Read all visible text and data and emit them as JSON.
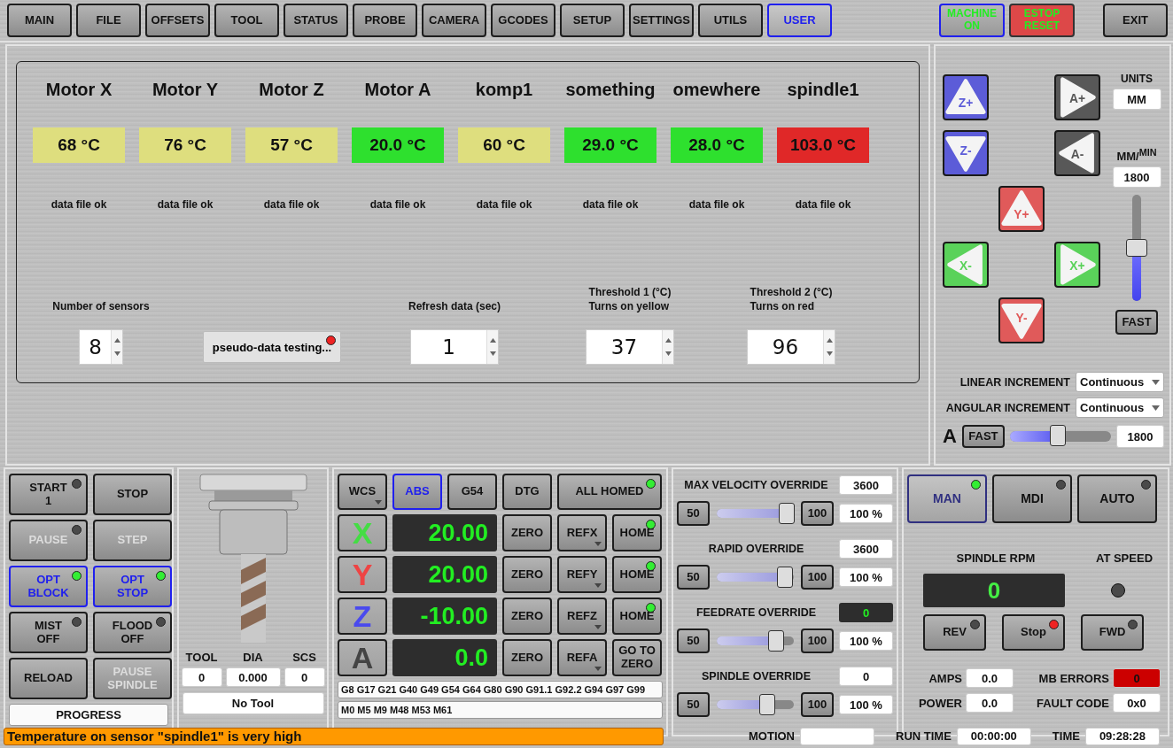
{
  "tabs": [
    {
      "label": "MAIN",
      "selected": false
    },
    {
      "label": "FILE",
      "selected": false
    },
    {
      "label": "OFFSETS",
      "selected": false
    },
    {
      "label": "TOOL",
      "selected": false
    },
    {
      "label": "STATUS",
      "selected": false
    },
    {
      "label": "PROBE",
      "selected": false
    },
    {
      "label": "CAMERA",
      "selected": false
    },
    {
      "label": "GCODES",
      "selected": false
    },
    {
      "label": "SETUP",
      "selected": false
    },
    {
      "label": "SETTINGS",
      "selected": false
    },
    {
      "label": "UTILS",
      "selected": false
    },
    {
      "label": "USER",
      "selected": true
    }
  ],
  "machine_buttons": [
    {
      "label": "MACHINE ON",
      "kind": "machine"
    },
    {
      "label": "ESTOP RESET",
      "kind": "estop"
    }
  ],
  "exit_button": "EXIT",
  "sensors": [
    {
      "name": "Motor X",
      "reading": "68 °C",
      "color": "#dede7e",
      "status": "data file ok"
    },
    {
      "name": "Motor Y",
      "reading": "76 °C",
      "color": "#dede7e",
      "status": "data file ok"
    },
    {
      "name": "Motor Z",
      "reading": "57 °C",
      "color": "#dede7e",
      "status": "data file ok"
    },
    {
      "name": "Motor A",
      "reading": "20.0 °C",
      "color": "#2ee02e",
      "status": "data file ok"
    },
    {
      "name": "komp1",
      "reading": "60 °C",
      "color": "#dede7e",
      "status": "data file ok"
    },
    {
      "name": "something",
      "reading": "29.0 °C",
      "color": "#2ee02e",
      "status": "data file ok"
    },
    {
      "name": "omewhere",
      "reading": "28.0 °C",
      "color": "#2ee02e",
      "status": "data file ok"
    },
    {
      "name": "spindle1",
      "reading": "103.0 °C",
      "color": "#e02828",
      "status": "data file ok"
    }
  ],
  "settings": [
    {
      "kind": "spin",
      "label": [
        "Number of sensors"
      ],
      "value": "8"
    },
    {
      "kind": "button",
      "label": [
        "pseudo-data testing..."
      ],
      "led": {
        "on": true,
        "color": "#ee2222"
      }
    },
    {
      "kind": "spin",
      "label": [
        "Refresh data (sec)"
      ],
      "value": "1"
    },
    {
      "kind": "spin",
      "label": [
        "Threshold 1 (°C)",
        "Turns on yellow"
      ],
      "value": "37"
    },
    {
      "kind": "spin",
      "label": [
        "Threshold 2 (°C)",
        "Turns on red"
      ],
      "value": "96"
    }
  ],
  "jog": {
    "buttons": [
      {
        "label": "Z+",
        "color": "#5c5cd8",
        "kind": "up"
      },
      {
        "label": "A+",
        "color": "#585858",
        "kind": "right"
      },
      {
        "label": "Z-",
        "color": "#5c5cd8",
        "kind": "down"
      },
      {
        "label": "A-",
        "color": "#585858",
        "kind": "left"
      },
      {
        "label": "Y+",
        "color": "#e05a5a",
        "kind": "up"
      },
      {
        "label": "X-",
        "color": "#5ad25a",
        "kind": "left"
      },
      {
        "label": "X+",
        "color": "#5ad25a",
        "kind": "right"
      },
      {
        "label": "Y-",
        "color": "#e05a5a",
        "kind": "down"
      }
    ],
    "units_label": "UNITS",
    "units": "MM",
    "rate_label": "MM/$^{MIN}$",
    "rate": "1800",
    "rate_slider": {
      "level": 0.5
    },
    "fast": "FAST",
    "increments": [
      {
        "label": "LINEAR INCREMENT",
        "value": "Continuous"
      },
      {
        "label": "ANGULAR INCREMENT",
        "value": "Continuous"
      }
    ],
    "angular": {
      "label": "A",
      "fast": "FAST",
      "level": 0.48,
      "rate": "1800"
    }
  },
  "program_buttons": [
    {
      "lines": [
        "START",
        "1"
      ],
      "led": {
        "on": false
      },
      "disabled": false,
      "active": false
    },
    {
      "lines": [
        "STOP"
      ],
      "disabled": false,
      "active": false
    },
    {
      "lines": [
        "PAUSE"
      ],
      "led": {
        "on": false
      },
      "disabled": true,
      "active": false
    },
    {
      "lines": [
        "STEP"
      ],
      "disabled": true,
      "active": false
    },
    {
      "lines": [
        "OPT",
        "BLOCK"
      ],
      "led": {
        "on": true,
        "color": "#33ee33"
      },
      "disabled": false,
      "active": true
    },
    {
      "lines": [
        "OPT",
        "STOP"
      ],
      "led": {
        "on": true,
        "color": "#33ee33"
      },
      "disabled": false,
      "active": true
    },
    {
      "lines": [
        "MIST",
        "OFF"
      ],
      "led": {
        "on": false
      },
      "disabled": false,
      "active": false
    },
    {
      "lines": [
        "FLOOD",
        "OFF"
      ],
      "led": {
        "on": false
      },
      "disabled": false,
      "active": false
    },
    {
      "lines": [
        "RELOAD"
      ],
      "disabled": false,
      "active": false
    },
    {
      "lines": [
        "PAUSE",
        "SPINDLE"
      ],
      "disabled": true,
      "active": false
    }
  ],
  "progress": {
    "label": "PROGRESS",
    "level": 0
  },
  "tool": {
    "columns": [
      {
        "label": "TOOL",
        "value": "0"
      },
      {
        "label": "DIA",
        "value": "0.000"
      },
      {
        "label": "SCS",
        "value": "0"
      }
    ],
    "description": "No Tool"
  },
  "dro": {
    "header": [
      {
        "label": "WCS",
        "kind": "dropdown",
        "selected": false
      },
      {
        "label": "ABS",
        "kind": "plain",
        "selected": true
      },
      {
        "label": "G54",
        "kind": "plain",
        "selected": false
      },
      {
        "label": "DTG",
        "kind": "plain",
        "selected": false
      }
    ],
    "homed": {
      "label": "ALL HOMED",
      "led": {
        "on": true,
        "color": "#33ee33"
      }
    },
    "axes": [
      {
        "axis": "X",
        "color": "#44dd44",
        "value": "20.00",
        "zero": "ZERO",
        "ref": "REFX",
        "home": "HOME",
        "home_led": {
          "on": true,
          "color": "#33ee33"
        }
      },
      {
        "axis": "Y",
        "color": "#ee4444",
        "value": "20.00",
        "zero": "ZERO",
        "ref": "REFY",
        "home": "HOME",
        "home_led": {
          "on": true,
          "color": "#33ee33"
        }
      },
      {
        "axis": "Z",
        "color": "#4a4aee",
        "value": "-10.00",
        "zero": "ZERO",
        "ref": "REFZ",
        "home": "HOME",
        "home_led": {
          "on": true,
          "color": "#33ee33"
        }
      },
      {
        "axis": "A",
        "color": "#444444",
        "value": "0.0",
        "zero": "ZERO",
        "ref": "REFA",
        "home": "GO TO ZERO"
      }
    ],
    "gcodes": [
      "G8 G17 G21 G40 G49 G54 G64 G80 G90 G91.1 G92.2 G94 G97 G99",
      "M0 M5 M9 M48 M53 M61"
    ]
  },
  "overrides": [
    {
      "title": "MAX VELOCITY OVERRIDE",
      "value": "3600",
      "kind": "field",
      "low": "50",
      "high": "100",
      "level": 0.92,
      "percent": "100 %"
    },
    {
      "title": "RAPID OVERRIDE",
      "value": "3600",
      "kind": "field",
      "low": "50",
      "high": "100",
      "level": 0.9,
      "percent": "100 %"
    },
    {
      "title": "FEEDRATE OVERRIDE",
      "value": "0",
      "kind": "display",
      "low": "50",
      "high": "100",
      "level": 0.78,
      "percent": "100 %"
    },
    {
      "title": "SPINDLE OVERRIDE",
      "value": "0",
      "kind": "field",
      "low": "50",
      "high": "100",
      "level": 0.67,
      "percent": "100 %"
    }
  ],
  "mode": {
    "buttons": [
      {
        "label": "MAN",
        "selected": true,
        "led": {
          "on": true,
          "color": "#33ee33"
        }
      },
      {
        "label": "MDI",
        "selected": false,
        "led": {
          "on": false
        }
      },
      {
        "label": "AUTO",
        "selected": false,
        "led": {
          "on": false
        }
      }
    ],
    "rpm_label": "SPINDLE RPM",
    "at_speed_label": "AT SPEED",
    "rpm": "0",
    "at_speed_led": {
      "on": false
    },
    "spindle_buttons": [
      {
        "label": "REV",
        "led": {
          "on": false
        }
      },
      {
        "label": "Stop",
        "led": {
          "on": true,
          "color": "#ee2222"
        }
      },
      {
        "label": "FWD",
        "led": {
          "on": false
        }
      }
    ],
    "readouts": [
      {
        "label": "AMPS",
        "value": "0.0",
        "alarm": false
      },
      {
        "label": "MB ERRORS",
        "value": "0",
        "alarm": true
      },
      {
        "label": "POWER",
        "value": "0.0",
        "alarm": false
      },
      {
        "label": "FAULT CODE",
        "value": "0x0",
        "alarm": false
      }
    ]
  },
  "status": {
    "message": "Temperature on sensor \"spindle1\" is very high",
    "motion_label": "MOTION",
    "fields": [
      {
        "label": "RUN TIME",
        "value": "00:00:00"
      },
      {
        "label": "TIME",
        "value": "09:28:28"
      }
    ]
  }
}
